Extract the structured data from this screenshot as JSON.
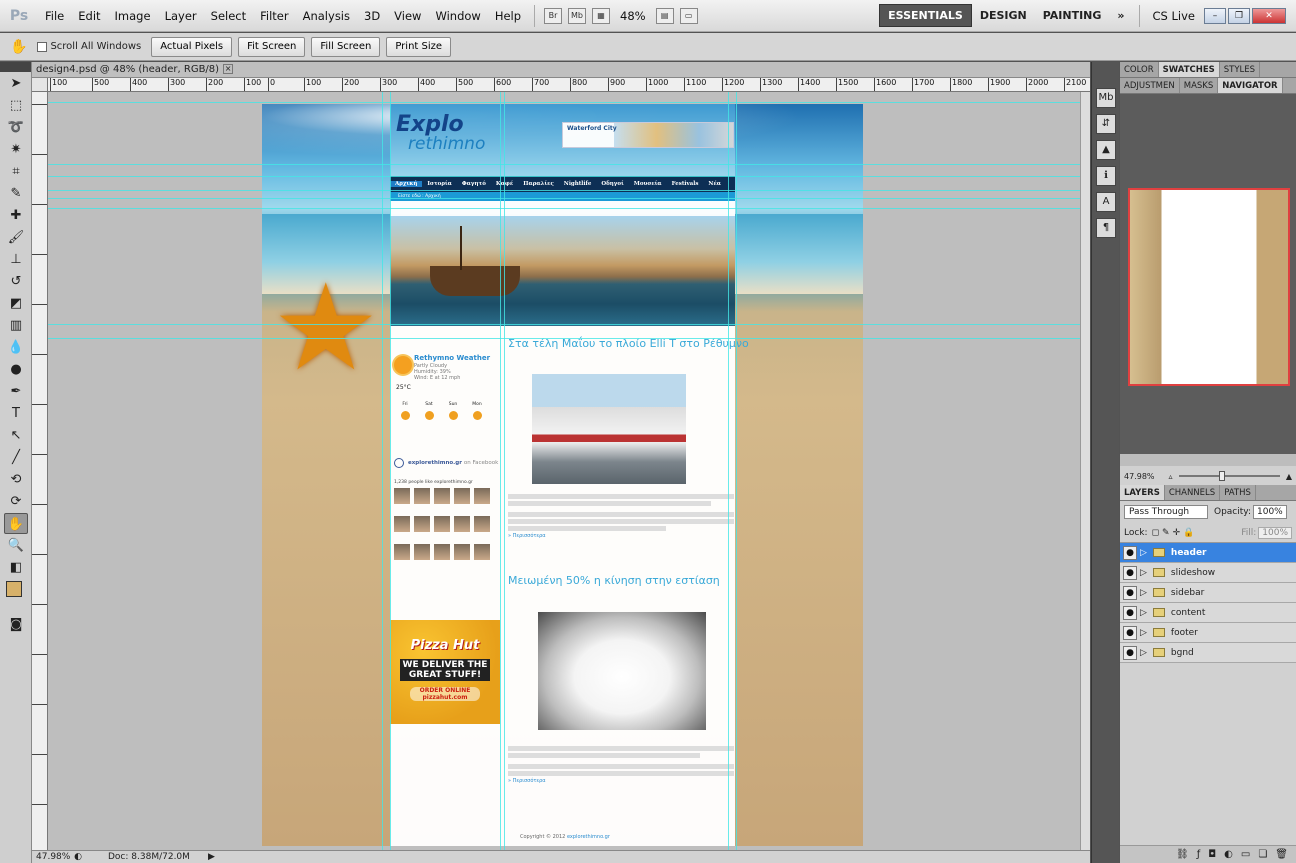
{
  "app": {
    "logo": "Ps",
    "menu": [
      "File",
      "Edit",
      "Image",
      "Layer",
      "Select",
      "Filter",
      "Analysis",
      "3D",
      "View",
      "Window",
      "Help"
    ],
    "mb_icons": [
      "Br",
      "Mb"
    ],
    "zoom_select": "48%",
    "workspaces": [
      "ESSENTIALS",
      "DESIGN",
      "PAINTING"
    ],
    "more": "»",
    "cslive": "CS Live"
  },
  "options": {
    "scroll_all": "Scroll All Windows",
    "buttons": [
      "Actual Pixels",
      "Fit Screen",
      "Fill Screen",
      "Print Size"
    ]
  },
  "document": {
    "tab": "design4.psd @ 48% (header, RGB/8)",
    "ruler_labels": [
      "100",
      "500",
      "400",
      "300",
      "200",
      "100",
      "0",
      "100",
      "200",
      "300",
      "400",
      "500",
      "600",
      "700",
      "800",
      "900",
      "1000",
      "1100",
      "1200",
      "1300",
      "1400",
      "1500",
      "1600",
      "1700",
      "1800",
      "1900",
      "2000",
      "2100"
    ],
    "status_zoom": "47.98%",
    "doc_size": "Doc: 8.38M/72.0M"
  },
  "artwork": {
    "logo_top": "Explo",
    "logo_bottom": "rethimno",
    "banner": "Waterford City",
    "nav": [
      "Αρχική",
      "Ιστορία",
      "Φαγητό",
      "Καφέ",
      "Παραλίες",
      "Nightlife",
      "Οδηγοί",
      "Μουσεία",
      "Festivals",
      "Νέα"
    ],
    "breadcrumb": "Είστε εδώ : Αρχική",
    "weather_title": "Rethymno Weather",
    "weather_sub": "Partly Cloudy",
    "weather_hum": "Humidity: 39%",
    "weather_wind": "Wind: E at 12 mph",
    "temp": "25°C",
    "days": [
      "Fri",
      "Sat",
      "Sun",
      "Mon"
    ],
    "fb_title": "explorethimno.gr",
    "fb_on": "on Facebook",
    "fb_count": "1,238 people like explorethimno.gr",
    "ad_brand": "Pizza Hut",
    "ad_line": "WE DELIVER THE GREAT STUFF!",
    "ad_order": "ORDER ONLINE pizzahut.com",
    "post1_title": "Στα τέλη Μαΐου το πλοίο Elli T στο Ρέθυμνο",
    "post2_title": "Μειωμένη 50% η κίνηση στην εστίαση",
    "more_link": "» Περισσότερα",
    "copyright": "Copyright © 2012",
    "copyright_site": "explorethimno.gr"
  },
  "panels": {
    "top_tabs": [
      "COLOR",
      "SWATCHES",
      "STYLES"
    ],
    "second_tabs": [
      "ADJUSTMEN",
      "MASKS",
      "NAVIGATOR"
    ],
    "nav_zoom": "47.98%",
    "layer_tabs": [
      "LAYERS",
      "CHANNELS",
      "PATHS"
    ],
    "blend": "Pass Through",
    "opacity_label": "Opacity:",
    "opacity": "100%",
    "lock_label": "Lock:",
    "fill_label": "Fill:",
    "fill": "100%",
    "layers": [
      {
        "name": "header",
        "selected": true
      },
      {
        "name": "slideshow"
      },
      {
        "name": "sidebar"
      },
      {
        "name": "content"
      },
      {
        "name": "footer"
      },
      {
        "name": "bgnd"
      }
    ]
  }
}
